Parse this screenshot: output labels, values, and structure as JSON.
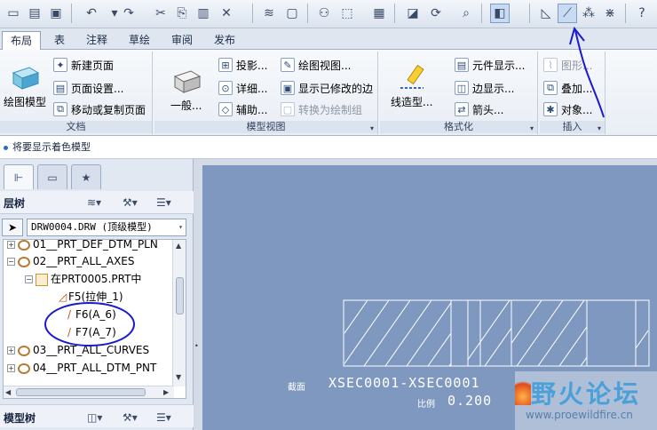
{
  "tabs": [
    "布局",
    "表",
    "注释",
    "草绘",
    "审阅",
    "发布"
  ],
  "active_tab": "布局",
  "ribbon": {
    "doc_group": {
      "label": "文档",
      "big_button": "绘图模型",
      "items": [
        "新建页面",
        "页面设置...",
        "移动或复制页面"
      ]
    },
    "model_views_group": {
      "label": "模型视图",
      "big_button": "一般...",
      "col1": [
        "投影...",
        "详细...",
        "辅助..."
      ],
      "col2": [
        "绘图视图...",
        "显示已修改的边",
        "转换为绘制组"
      ]
    },
    "format_group": {
      "label": "格式化",
      "big_button": "线造型...",
      "items": [
        "元件显示...",
        "边显示...",
        "箭头..."
      ]
    },
    "insert_group": {
      "label": "插入",
      "items": [
        "图形...",
        "叠加...",
        "对象..."
      ]
    }
  },
  "message": "将要显示着色模型",
  "panel": {
    "layer_tree_title": "层树",
    "model_tree_title": "模型树",
    "path_combo": "DRW0004.DRW (顶级模型)",
    "tree_rows": [
      {
        "toggle": "+",
        "label": "01__PRT_DEF_DTM_PLN"
      },
      {
        "toggle": "−",
        "label": "02__PRT_ALL_AXES"
      },
      {
        "toggle": "−",
        "label": "在PRT0005.PRT中"
      },
      {
        "toggle": "",
        "label": "F5(拉伸_1)"
      },
      {
        "toggle": "",
        "label": "F6(A_6)"
      },
      {
        "toggle": "",
        "label": "F7(A_7)"
      },
      {
        "toggle": "+",
        "label": "03__PRT_ALL_CURVES"
      },
      {
        "toggle": "+",
        "label": "04__PRT_ALL_DTM_PNT"
      }
    ]
  },
  "drawing": {
    "section_prefix": "截面",
    "section_name": "XSEC0001-XSEC0001",
    "scale_prefix": "比例",
    "scale_value": "0.200"
  },
  "watermark": {
    "title": "野火论坛",
    "url": "www.proewildfire.cn"
  },
  "colors": {
    "drawing_bg": "#7f98bf",
    "annotation": "#1a1ad0"
  }
}
